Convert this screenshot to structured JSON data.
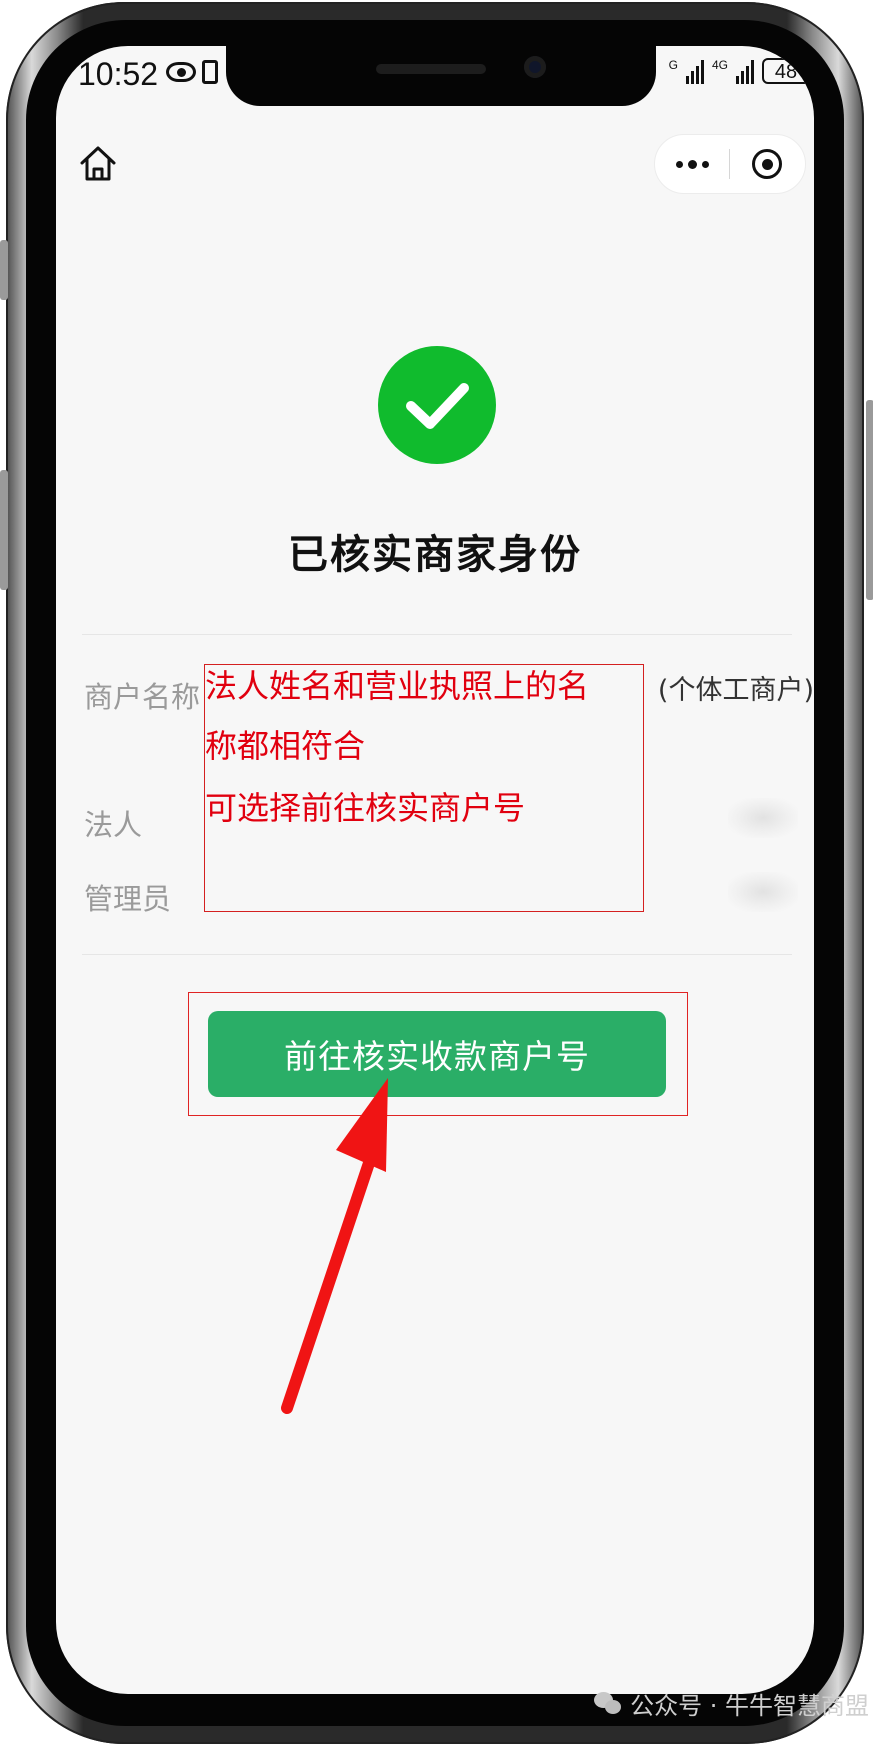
{
  "status_bar": {
    "time": "10:52",
    "network_label_1": "G",
    "network_label_2": "4G",
    "battery": "48"
  },
  "page": {
    "title": "已核实商家身份"
  },
  "info": {
    "merchant_name_label": "商户名称",
    "merchant_name_value": "(个体工商户)",
    "legal_person_label": "法人",
    "admin_label": "管理员"
  },
  "primary_button": {
    "label": "前往核实收款商户号"
  },
  "annotation": {
    "line1": "法人姓名和营业执照上的名",
    "line2": "称都相符合",
    "line3": "可选择前往核实商户号"
  },
  "watermark": {
    "text": "公众号 · 牛牛智慧商盟"
  },
  "colors": {
    "success_green": "#10bb2d",
    "button_green": "#2aae67",
    "annotation_red": "#e1000f"
  }
}
